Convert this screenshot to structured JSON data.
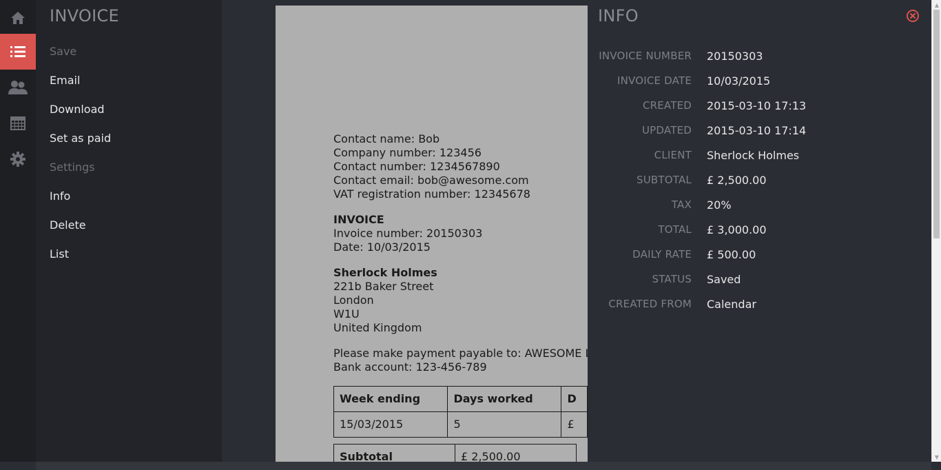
{
  "rail": {
    "items": [
      {
        "icon": "home-icon"
      },
      {
        "icon": "list-icon",
        "active": true
      },
      {
        "icon": "users-icon"
      },
      {
        "icon": "calendar-icon"
      },
      {
        "icon": "gear-icon"
      }
    ],
    "active_color": "#d9534f"
  },
  "menu": {
    "title": "INVOICE",
    "items": [
      {
        "label": "Save",
        "disabled": true
      },
      {
        "label": "Email"
      },
      {
        "label": "Download"
      },
      {
        "label": "Set as paid"
      },
      {
        "label": "Settings",
        "disabled": true
      },
      {
        "label": "Info"
      },
      {
        "label": "Delete"
      },
      {
        "label": "List"
      }
    ]
  },
  "document": {
    "contact": {
      "name": "Contact name: Bob",
      "company": "Company number: 123456",
      "number": "Contact number: 1234567890",
      "email": "Contact email: bob@awesome.com",
      "vat": "VAT registration number: 12345678"
    },
    "invoice": {
      "heading": "INVOICE",
      "number": "Invoice number: 20150303",
      "date": "Date: 10/03/2015"
    },
    "client": {
      "name": "Sherlock Holmes",
      "street": "221b Baker Street",
      "city": "London",
      "postcode": "W1U",
      "country": "United Kingdom"
    },
    "payment": {
      "payable": "Please make payment payable to: AWESOME LTD",
      "bank": "Bank account: 123-456-789"
    },
    "table": {
      "headers": [
        "Week ending",
        "Days worked",
        "D"
      ],
      "rows": [
        [
          "15/03/2015",
          "5",
          "£"
        ]
      ]
    },
    "totals": {
      "label": "Subtotal",
      "value": "£ 2,500.00"
    }
  },
  "info": {
    "title": "INFO",
    "close_icon": "close-circle-icon",
    "rows": [
      {
        "label": "INVOICE NUMBER",
        "value": "20150303"
      },
      {
        "label": "INVOICE DATE",
        "value": "10/03/2015"
      },
      {
        "label": "CREATED",
        "value": "2015-03-10 17:13"
      },
      {
        "label": "UPDATED",
        "value": "2015-03-10 17:14"
      },
      {
        "label": "CLIENT",
        "value": "Sherlock Holmes"
      },
      {
        "label": "SUBTOTAL",
        "value": "£ 2,500.00"
      },
      {
        "label": "TAX",
        "value": "20%"
      },
      {
        "label": "TOTAL",
        "value": "£ 3,000.00"
      },
      {
        "label": "DAILY RATE",
        "value": "£ 500.00"
      },
      {
        "label": "STATUS",
        "value": "Saved"
      },
      {
        "label": "CREATED FROM",
        "value": "Calendar"
      }
    ]
  },
  "scrollbar": {
    "up_glyph": "▲",
    "down_glyph": "▼"
  }
}
